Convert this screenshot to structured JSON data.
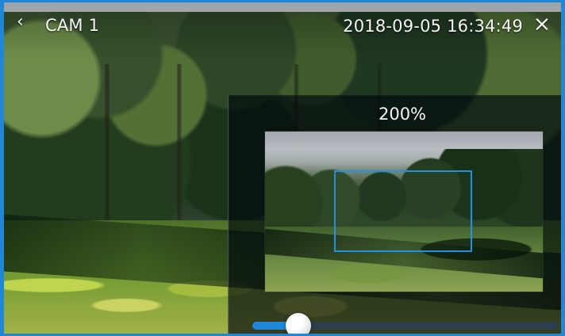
{
  "header": {
    "back_icon": "‹",
    "camera_name": "CAM 1",
    "timestamp": "2018-09-05 16:34:49",
    "close_icon": "×"
  },
  "zoom": {
    "label": "200%",
    "slider_value_percent": 15
  },
  "colors": {
    "accent": "#1f86d8",
    "panel_background": "rgba(0, 7, 12, 0.67)",
    "slider_track": "#2d3f4c"
  }
}
